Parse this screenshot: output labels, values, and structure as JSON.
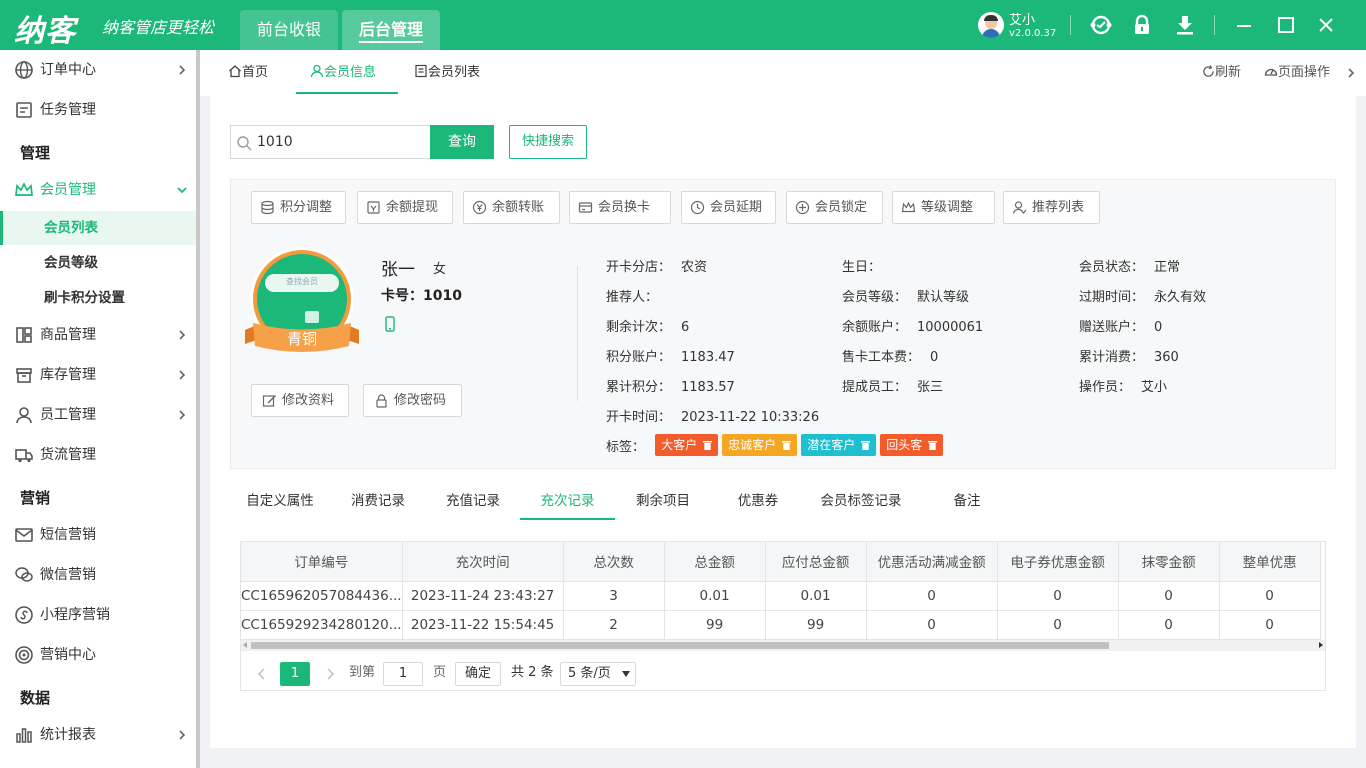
{
  "app": {
    "logo": "纳客",
    "slogan": "纳客管店更轻松",
    "top_tabs": [
      "前台收银",
      "后台管理"
    ],
    "user": {
      "name": "艾小",
      "version": "v2.0.0.37"
    }
  },
  "sidebar": {
    "order_center": "订单中心",
    "task_mgmt": "任务管理",
    "group_manage": "管理",
    "member_mgmt": "会员管理",
    "member_list": "会员列表",
    "member_level": "会员等级",
    "card_points": "刷卡积分设置",
    "goods_mgmt": "商品管理",
    "stock_mgmt": "库存管理",
    "staff_mgmt": "员工管理",
    "logistics_mgmt": "货流管理",
    "group_marketing": "营销",
    "sms_marketing": "短信营销",
    "wechat_marketing": "微信营销",
    "miniapp_marketing": "小程序营销",
    "marketing_center": "营销中心",
    "group_data": "数据",
    "stat_report": "统计报表"
  },
  "navtabs": {
    "home": "首页",
    "member_info": "会员信息",
    "member_list": "会员列表",
    "refresh": "刷新",
    "page_ops": "页面操作"
  },
  "search": {
    "value": "1010",
    "query_label": "查询",
    "quick_label": "快捷搜索"
  },
  "actions": [
    "积分调整",
    "余额提现",
    "余额转账",
    "会员换卡",
    "会员延期",
    "会员锁定",
    "等级调整",
    "推荐列表"
  ],
  "member": {
    "name": "张一",
    "sex": "女",
    "card_label": "卡号：",
    "card_no": "1010",
    "level_badge": "青铜",
    "badge_search": "查找会员",
    "edit_profile": "修改资料",
    "edit_password": "修改密码"
  },
  "fields": {
    "branch_k": "开卡分店：",
    "branch_v": "农资",
    "birthday_k": "生日：",
    "birthday_v": "",
    "status_k": "会员状态：",
    "status_v": "正常",
    "referrer_k": "推荐人：",
    "referrer_v": "",
    "level_k": "会员等级：",
    "level_v": "默认等级",
    "expire_k": "过期时间：",
    "expire_v": "永久有效",
    "times_k": "剩余计次：",
    "times_v": "6",
    "balance_k": "余额账户：",
    "balance_v": "10000061",
    "gift_k": "赠送账户：",
    "gift_v": "0",
    "points_k": "积分账户：",
    "points_v": "1183.47",
    "cardfee_k": "售卡工本费：",
    "cardfee_v": "0",
    "consume_k": "累计消费：",
    "consume_v": "360",
    "total_points_k": "累计积分：",
    "total_points_v": "1183.57",
    "commission_k": "提成员工：",
    "commission_v": "张三",
    "operator_k": "操作员：",
    "operator_v": "艾小",
    "open_time_k": "开卡时间：",
    "open_time_v": "2023-11-22 10:33:26",
    "tags_k": "标签："
  },
  "tags": [
    {
      "label": "大客户",
      "color": "#f25c2a"
    },
    {
      "label": "忠诚客户",
      "color": "#f5a623"
    },
    {
      "label": "潜在客户",
      "color": "#1dbfd0"
    },
    {
      "label": "回头客",
      "color": "#f25c2a"
    }
  ],
  "record_tabs": [
    "自定义属性",
    "消费记录",
    "充值记录",
    "充次记录",
    "剩余项目",
    "优惠券",
    "会员标签记录",
    "备注"
  ],
  "table": {
    "headers": [
      "订单编号",
      "充次时间",
      "总次数",
      "总金额",
      "应付总金额",
      "优惠活动满减金额",
      "电子券优惠金额",
      "抹零金额",
      "整单优惠"
    ],
    "rows": [
      [
        "CC165962057084436...",
        "2023-11-24 23:43:27",
        "3",
        "0.01",
        "0.01",
        "0",
        "0",
        "0",
        "0"
      ],
      [
        "CC165929234280120...",
        "2023-11-22 15:54:45",
        "2",
        "99",
        "99",
        "0",
        "0",
        "0",
        "0"
      ]
    ]
  },
  "pager": {
    "current": "1",
    "goto_label": "到第",
    "page_input": "1",
    "page_unit": "页",
    "confirm": "确定",
    "total": "共 2 条",
    "page_size": "5 条/页"
  },
  "colors": {
    "brand": "#1cb87a"
  }
}
